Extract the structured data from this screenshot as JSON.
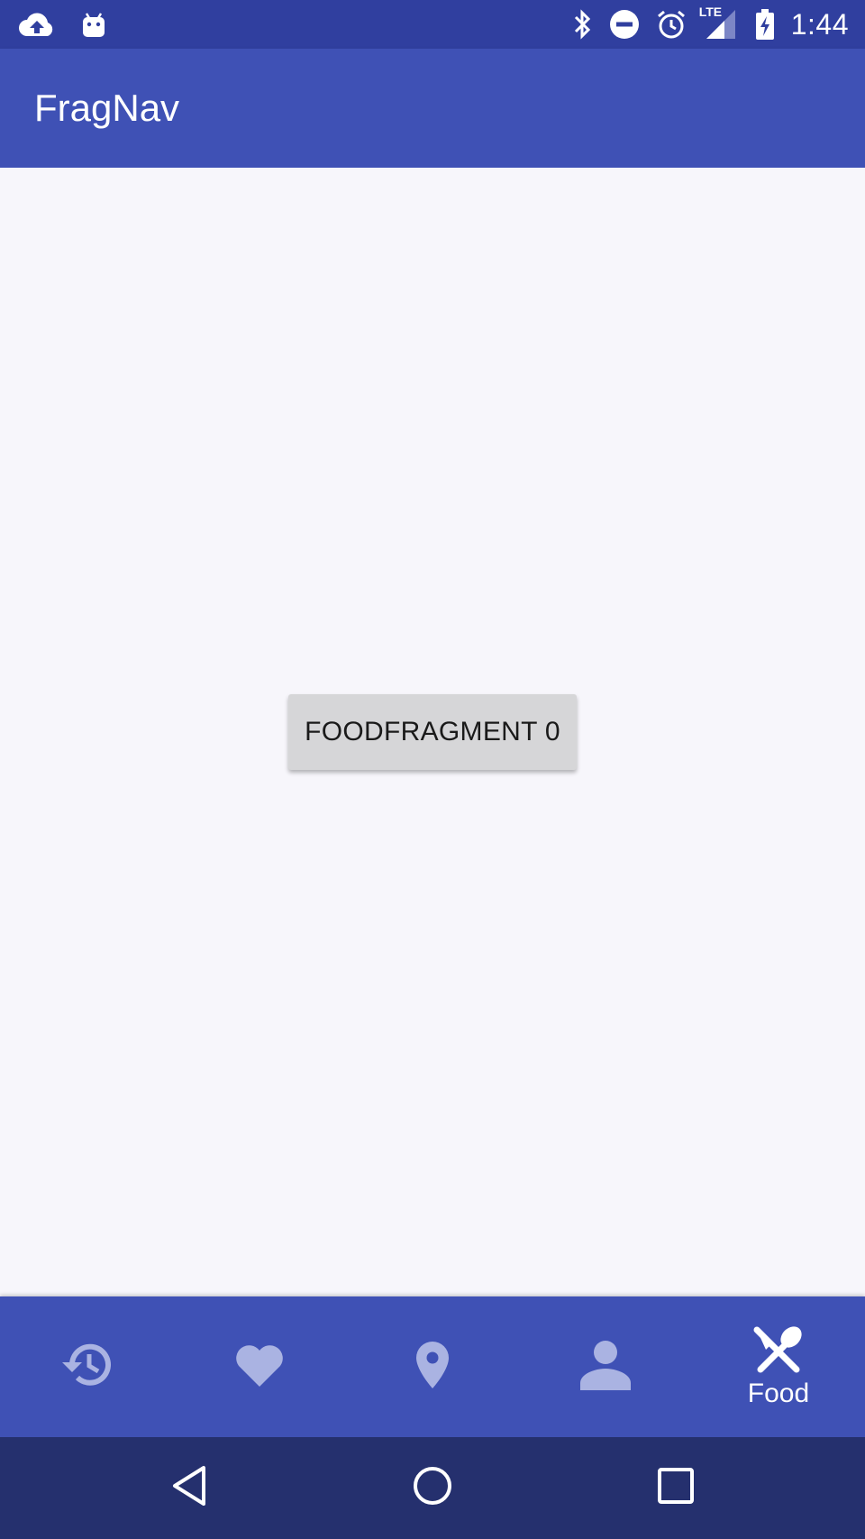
{
  "status_bar": {
    "time": "1:44",
    "network_label": "LTE",
    "left_icons": [
      "cloud-upload-icon",
      "android-icon"
    ],
    "right_icons": [
      "bluetooth-icon",
      "do-not-disturb-icon",
      "alarm-icon",
      "signal-lte-icon",
      "battery-charging-icon"
    ]
  },
  "app_bar": {
    "title": "FragNav"
  },
  "content": {
    "button_label": "FOODFRAGMENT 0"
  },
  "bottom_nav": {
    "tabs": [
      {
        "icon": "history-icon",
        "label": "",
        "active": false
      },
      {
        "icon": "heart-icon",
        "label": "",
        "active": false
      },
      {
        "icon": "location-pin-icon",
        "label": "",
        "active": false
      },
      {
        "icon": "person-icon",
        "label": "",
        "active": false
      },
      {
        "icon": "restaurant-icon",
        "label": "Food",
        "active": true
      }
    ],
    "active_color": "#ffffff",
    "inactive_color": "#aab3e2"
  },
  "system_nav": {
    "buttons": [
      "back-icon",
      "home-icon",
      "recents-icon"
    ]
  },
  "colors": {
    "status_bar": "#303f9f",
    "primary": "#3f51b5",
    "system_nav": "#25306e",
    "background": "#f7f6fb",
    "button": "#d6d6d8"
  }
}
